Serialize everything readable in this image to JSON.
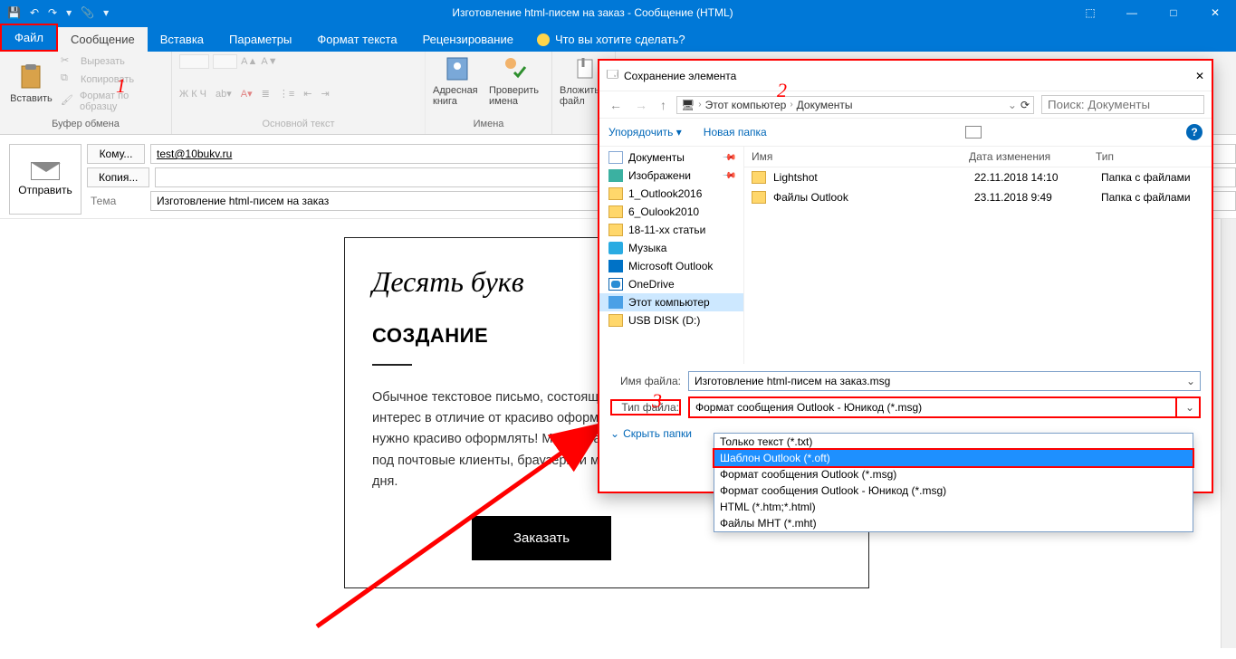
{
  "window": {
    "title": "Изготовление html-писем на заказ - Сообщение (HTML)"
  },
  "qat": {
    "save": "💾",
    "undo": "↶",
    "redo": "↷",
    "attach": "📎",
    "dd": "▾"
  },
  "tabs": {
    "file": "Файл",
    "message": "Сообщение",
    "insert": "Вставка",
    "options": "Параметры",
    "format": "Формат текста",
    "review": "Рецензирование",
    "tell": "Что вы хотите сделать?"
  },
  "ribbon": {
    "paste": "Вставить",
    "cut": "Вырезать",
    "copy": "Копировать",
    "fmt": "Формат по образцу",
    "clipboard_label": "Буфер обмена",
    "font_label": "Основной текст",
    "font_letters": "Ж  К  Ч",
    "addressbook": "Адресная книга",
    "checknames": "Проверить имена",
    "names_label": "Имена",
    "attachfile": "Вложить файл"
  },
  "fields": {
    "send": "Отправить",
    "to_btn": "Кому...",
    "to_val": "test@10bukv.ru",
    "cc_btn": "Копия...",
    "subj_label": "Тема",
    "subj_val": "Изготовление html-писем на заказ"
  },
  "email": {
    "brand": "Десять букв",
    "heading": "СОЗДАНИЕ",
    "body": "Обычное текстовое письмо, состоящее только из текста, редко вызывает интерес в отличие от красиво оформленного. Чтобы рассылки работали, их нужно красиво оформлять! Мы разрабатываем письма любой сложности под почтовые клиенты, браузеры и мобильные устройства, максимум, за 3 дня.",
    "cta": "Заказать"
  },
  "dialog": {
    "title": "Сохранение элемента",
    "crumb1": "Этот компьютер",
    "crumb2": "Документы",
    "search_ph": "Поиск: Документы",
    "organize": "Упорядочить",
    "newfolder": "Новая папка",
    "tree": {
      "docs": "Документы",
      "img": "Изображени",
      "f1": "1_Outlook2016",
      "f2": "6_Oulook2010",
      "f3": "18-11-xx статьи",
      "music": "Музыка",
      "mso": "Microsoft Outlook",
      "od": "OneDrive",
      "pc": "Этот компьютер",
      "usb": "USB DISK (D:)"
    },
    "cols": {
      "name": "Имя",
      "date": "Дата изменения",
      "type": "Тип"
    },
    "rows": [
      {
        "name": "Lightshot",
        "date": "22.11.2018 14:10",
        "type": "Папка с файлами"
      },
      {
        "name": "Файлы Outlook",
        "date": "23.11.2018 9:49",
        "type": "Папка с файлами"
      }
    ],
    "filename_label": "Имя файла:",
    "filename": "Изготовление html-писем на заказ.msg",
    "filetype_label": "Тип файла:",
    "filetype": "Формат сообщения Outlook - Юникод (*.msg)",
    "hide": "Скрыть папки",
    "options": {
      "o1": "Только текст (*.txt)",
      "o2": "Шаблон Outlook (*.oft)",
      "o3": "Формат сообщения Outlook (*.msg)",
      "o4": "Формат сообщения Outlook - Юникод (*.msg)",
      "o5": "HTML (*.htm;*.html)",
      "o6": "Файлы MHT (*.mht)"
    }
  },
  "markers": {
    "m1": "1",
    "m2": "2",
    "m3": "3"
  }
}
